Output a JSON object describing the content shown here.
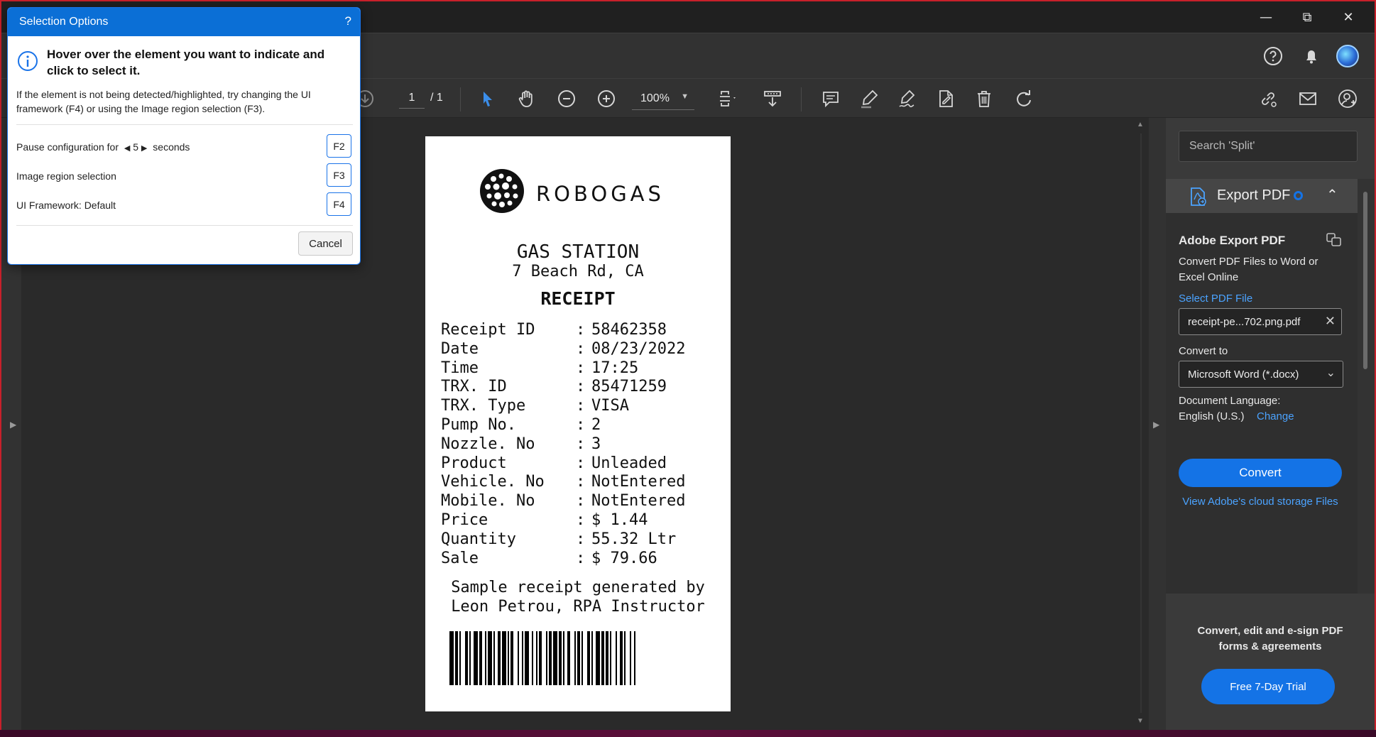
{
  "dialog": {
    "title": "Selection Options",
    "help": "?",
    "heading": "Hover over the element you want to indicate and click to select it.",
    "description": "If the element is not being detected/highlighted, try changing the UI framework (F4) or using the Image region selection (F3).",
    "pause": {
      "prefix": "Pause configuration for",
      "value": "5",
      "suffix": "seconds",
      "key": "F2"
    },
    "image_region": {
      "label": "Image region selection",
      "key": "F3"
    },
    "ui_framework": {
      "label": "UI Framework:",
      "value": "Default",
      "key": "F4"
    },
    "cancel": "Cancel"
  },
  "toolbar": {
    "page_current": "1",
    "page_total": "/ 1",
    "zoom": "100%"
  },
  "receipt": {
    "brand": "ROBOGAS",
    "station": "GAS STATION",
    "address": "7 Beach Rd, CA",
    "heading": "RECEIPT",
    "rows": [
      {
        "label": "Receipt ID",
        "value": "58462358"
      },
      {
        "label": "Date",
        "value": "08/23/2022"
      },
      {
        "label": "Time",
        "value": "17:25"
      },
      {
        "label": "TRX. ID",
        "value": "85471259"
      },
      {
        "label": "TRX. Type",
        "value": "VISA"
      },
      {
        "label": "Pump No.",
        "value": "2"
      },
      {
        "label": "Nozzle. No",
        "value": "3"
      },
      {
        "label": "Product",
        "value": "Unleaded"
      },
      {
        "label": "Vehicle. No",
        "value": "NotEntered"
      },
      {
        "label": "Mobile. No",
        "value": "NotEntered"
      },
      {
        "label": "Price",
        "value": "$ 1.44"
      },
      {
        "label": "Quantity",
        "value": "55.32 Ltr"
      },
      {
        "label": "Sale",
        "value": "$ 79.66"
      }
    ],
    "footer_line1": "Sample receipt generated by",
    "footer_line2": "Leon Petrou, RPA Instructor"
  },
  "right_panel": {
    "search_placeholder": "Search 'Split'",
    "section_title": "Export PDF",
    "tool_title": "Adobe Export PDF",
    "tool_desc": "Convert PDF Files to Word or Excel Online",
    "select_file_label": "Select PDF File",
    "file_name": "receipt-pe...702.png.pdf",
    "convert_to_label": "Convert to",
    "convert_to_value": "Microsoft Word (*.docx)",
    "doc_language_label": "Document Language:",
    "doc_language_value": "English (U.S.)",
    "change_link": "Change",
    "convert_button": "Convert",
    "cloud_link": "View Adobe's cloud storage Files",
    "promo_text": "Convert, edit and e-sign PDF forms & agreements",
    "trial_button": "Free 7-Day Trial"
  },
  "colors": {
    "accent": "#1473e6",
    "dialog_title_bg": "#0b6fd6",
    "frame_border": "#c8202a"
  },
  "icons": [
    "help-circle-icon",
    "bell-icon",
    "avatar",
    "download-icon",
    "select-arrow-icon",
    "hand-icon",
    "zoom-out-icon",
    "zoom-in-icon",
    "fit-page-icon",
    "scroll-mode-icon",
    "comment-icon",
    "highlight-icon",
    "sign-icon",
    "edit-icon",
    "delete-icon",
    "rotate-icon",
    "share-link-icon",
    "email-icon",
    "add-user-icon",
    "export-pdf-icon",
    "info-icon",
    "clear-icon",
    "chevron-down-icon",
    "chevron-up-icon"
  ]
}
